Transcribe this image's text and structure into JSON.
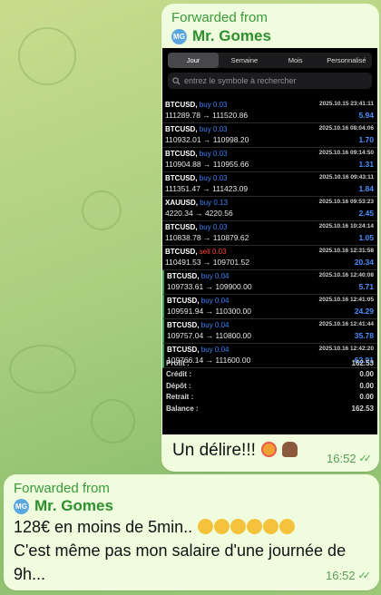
{
  "top_message": {
    "forwarded_label": "Forwarded from",
    "sender_name": "Mr. Gomes",
    "avatar_initials": "MG",
    "caption": "Un délire!!!",
    "time": "16:52",
    "embedded_screenshot": {
      "tabs": [
        {
          "label": "Jour",
          "active": true
        },
        {
          "label": "Semaine",
          "active": false
        },
        {
          "label": "Mois",
          "active": false
        },
        {
          "label": "Personnalisé",
          "active": false
        }
      ],
      "search_placeholder": "entrez le symbole à rechercher",
      "trades": [
        {
          "symbol": "BTCUSD,",
          "side": "buy 0.03",
          "prices": "111289.78 → 111520.86",
          "date": "2025.10.15 23:41:11",
          "profit": "5.94"
        },
        {
          "symbol": "BTCUSD,",
          "side": "buy 0.03",
          "prices": "110932.01 → 110998.20",
          "date": "2025.10.16 08:04:06",
          "profit": "1.70"
        },
        {
          "symbol": "BTCUSD,",
          "side": "buy 0.03",
          "prices": "110904.88 → 110955.66",
          "date": "2025.10.16 09:14:50",
          "profit": "1.31"
        },
        {
          "symbol": "BTCUSD,",
          "side": "buy 0.03",
          "prices": "111351.47 → 111423.09",
          "date": "2025.10.16 09:43:11",
          "profit": "1.84"
        },
        {
          "symbol": "XAUUSD,",
          "side": "buy 0.13",
          "prices": "4220.34 → 4220.56",
          "date": "2025.10.16 09:53:23",
          "profit": "2.45"
        },
        {
          "symbol": "BTCUSD,",
          "side": "buy 0.03",
          "prices": "110838.78 → 110879.62",
          "date": "2025.10.16 10:24:14",
          "profit": "1.05"
        },
        {
          "symbol": "BTCUSD,",
          "side": "sell 0.03",
          "prices": "110491.53 → 109701.52",
          "date": "2025.10.16 12:31:58",
          "profit": "20.34"
        },
        {
          "symbol": "BTCUSD,",
          "side": "buy 0.04",
          "prices": "109733.61 → 109900.00",
          "date": "2025.10.16 12:40:08",
          "profit": "5.71"
        },
        {
          "symbol": "BTCUSD,",
          "side": "buy 0.04",
          "prices": "109591.94 → 110300.00",
          "date": "2025.10.16 12:41:05",
          "profit": "24.29"
        },
        {
          "symbol": "BTCUSD,",
          "side": "buy 0.04",
          "prices": "109757.04 → 110800.00",
          "date": "2025.10.16 12:41:44",
          "profit": "35.78"
        },
        {
          "symbol": "BTCUSD,",
          "side": "buy 0.04",
          "prices": "109766.14 → 111600.00",
          "date": "2025.10.16 12:42:20",
          "profit": "62.91"
        }
      ],
      "summary": [
        {
          "label": "Profit :",
          "value": "162.53"
        },
        {
          "label": "Crédit :",
          "value": "0.00"
        },
        {
          "label": "Dépôt :",
          "value": "0.00"
        },
        {
          "label": "Retrait :",
          "value": "0.00"
        },
        {
          "label": "Balance :",
          "value": "162.53"
        }
      ]
    }
  },
  "bottom_message": {
    "forwarded_label": "Forwarded from",
    "sender_name": "Mr. Gomes",
    "avatar_initials": "MG",
    "line1": "128€ en moins de 5min..",
    "line2": "C'est même pas mon salaire d'une journée de",
    "line3": "9h...",
    "time": "16:52"
  },
  "colors": {
    "bubble": "#effdde",
    "accent_green": "#3a9a3a",
    "buy_blue": "#3b82f6",
    "sell_red": "#ff453a"
  }
}
